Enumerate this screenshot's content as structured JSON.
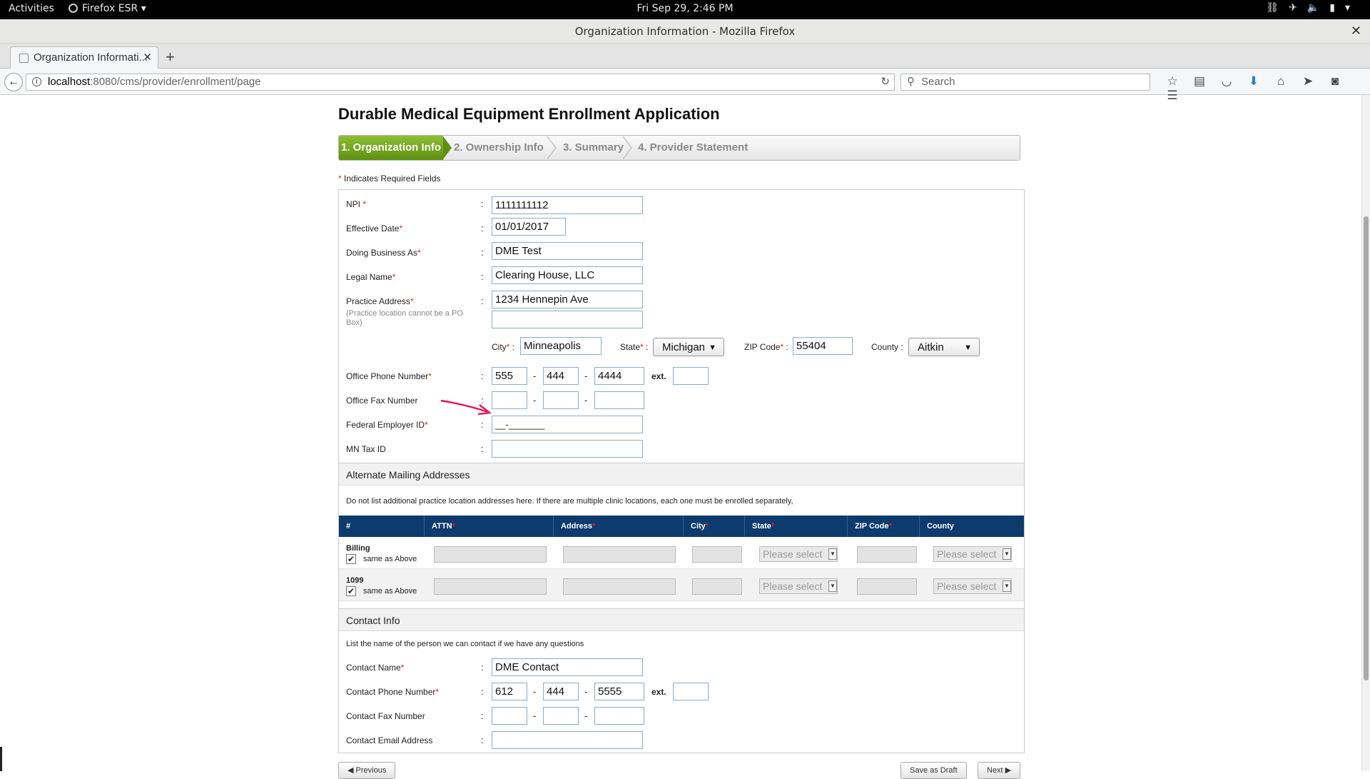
{
  "topbar": {
    "activities": "Activities",
    "app_name": "Firefox ESR ▾",
    "clock": "Fri Sep 29,  2:46 PM",
    "tray_icons": [
      "network-icon",
      "airplane-icon",
      "volume-icon",
      "battery-icon",
      "chevron-down-icon"
    ]
  },
  "window": {
    "title": "Organization Information - Mozilla Firefox"
  },
  "tabs": [
    {
      "label": "Organization Informati..."
    }
  ],
  "navbar": {
    "url_host": "localhost",
    "url_rest": ":8080/cms/provider/enrollment/page",
    "search_placeholder": "Search"
  },
  "page": {
    "title": "Durable Medical Equipment Enrollment Application",
    "steps": [
      "1. Organization Info",
      "2. Ownership Info",
      "3. Summary",
      "4. Provider Statement"
    ],
    "required_note": "Indicates Required Fields"
  },
  "form": {
    "npi": {
      "label": "NPI",
      "value": "1111111112"
    },
    "effective_date": {
      "label": "Effective Date",
      "value": "01/01/2017"
    },
    "dba": {
      "label": "Doing Business As",
      "value": "DME Test"
    },
    "legal_name": {
      "label": "Legal Name",
      "value": "Clearing House, LLC"
    },
    "practice_address": {
      "label": "Practice Address",
      "hint": "(Practice location cannot be a PO Box)",
      "line1": "1234 Hennepin Ave",
      "line2": ""
    },
    "city": {
      "label": "City",
      "value": "Minneapolis"
    },
    "state": {
      "label": "State",
      "value": "Michigan"
    },
    "zip": {
      "label": "ZIP Code",
      "value": "55404"
    },
    "county": {
      "label": "County",
      "value": "Aitkin"
    },
    "office_phone": {
      "label": "Office Phone Number",
      "p1": "555",
      "p2": "444",
      "p3": "4444",
      "ext_label": "ext."
    },
    "office_fax": {
      "label": "Office Fax Number"
    },
    "fein": {
      "label": "Federal Employer ID",
      "value": "__-_______"
    },
    "mn_tax": {
      "label": "MN Tax ID"
    }
  },
  "alt_mailing": {
    "heading": "Alternate Mailing Addresses",
    "note": "Do not list additional practice location addresses here. If there are multiple clinic locations, each one must be enrolled separately,",
    "columns": [
      "#",
      "ATTN",
      "Address",
      "City",
      "State",
      "ZIP Code",
      "County"
    ],
    "rows": [
      {
        "label": "Billing",
        "same": "same as Above",
        "state": "Please select",
        "county": "Please select"
      },
      {
        "label": "1099",
        "same": "same as Above",
        "state": "Please select",
        "county": "Please select"
      }
    ]
  },
  "contact": {
    "heading": "Contact Info",
    "note": "List the name of the person we can contact if we have any questions",
    "name": {
      "label": "Contact Name",
      "value": "DME Contact"
    },
    "phone": {
      "label": "Contact Phone Number",
      "p1": "612",
      "p2": "444",
      "p3": "5555",
      "ext_label": "ext."
    },
    "fax": {
      "label": "Contact Fax Number"
    },
    "email": {
      "label": "Contact Email Address"
    }
  },
  "buttons": {
    "previous": "◀ Previous",
    "save_draft": "Save as Draft",
    "next": "Next ▶"
  },
  "colors": {
    "step_active": "#6fa11d",
    "table_header": "#0e3b6d",
    "required_star": "#dd2222",
    "annotation_arrow": "#e8195a"
  }
}
